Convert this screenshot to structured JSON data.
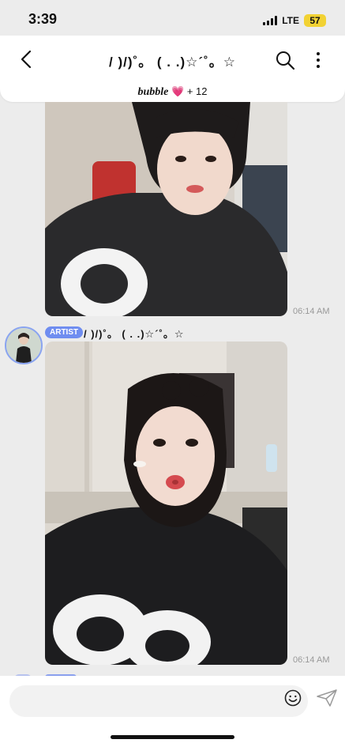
{
  "status_bar": {
    "time": "3:39",
    "network": "LTE",
    "battery": "57"
  },
  "header": {
    "title": "/ )/)˚。 ( . .)☆´˚。☆",
    "subtitle_brand": "bubble",
    "subtitle_heart": "💗",
    "subtitle_count": "+ 12"
  },
  "messages": [
    {
      "type": "image",
      "time": "06:14 AM"
    },
    {
      "type": "image",
      "badge": "ARTIST",
      "sender": "/ )/)˚。 ( . .)☆´˚。☆",
      "time": "06:14 AM"
    }
  ],
  "icons": {
    "back": "chevron-left-icon",
    "search": "search-icon",
    "more": "more-vertical-icon",
    "emoji": "smiley-icon",
    "send": "paper-plane-icon"
  },
  "colors": {
    "background": "#ececec",
    "artist_badge": "#6f8df0",
    "heart": "#f47ab9",
    "battery": "#f2d233"
  }
}
